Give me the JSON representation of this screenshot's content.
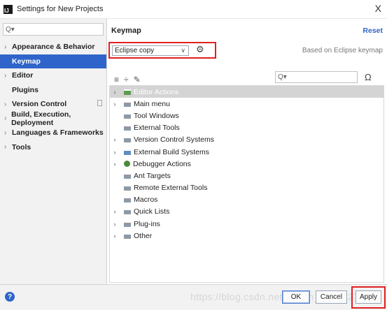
{
  "window": {
    "title": "Settings for New Projects",
    "app_icon_text": "IJ",
    "close_glyph": "X"
  },
  "sidebar": {
    "search_placeholder": "Q▾",
    "items": [
      {
        "label": "Appearance & Behavior",
        "expandable": true
      },
      {
        "label": "Keymap",
        "selected": true
      },
      {
        "label": "Editor",
        "expandable": true
      },
      {
        "label": "Plugins"
      },
      {
        "label": "Version Control",
        "expandable": true
      },
      {
        "label": "Build, Execution, Deployment",
        "expandable": true
      },
      {
        "label": "Languages & Frameworks",
        "expandable": true
      },
      {
        "label": "Tools",
        "expandable": true
      }
    ]
  },
  "main": {
    "section_title": "Keymap",
    "reset_label": "Reset",
    "scheme_value": "Eclipse copy",
    "based_on": "Based on Eclipse keymap",
    "toolbar_icons": [
      "expand-all-icon",
      "collapse-all-icon",
      "edit-icon"
    ],
    "tree_search_placeholder": "Q▾",
    "tree": [
      {
        "label": "Editor Actions",
        "arrow": true,
        "icon": "editor-actions",
        "selected": true
      },
      {
        "label": "Main menu",
        "arrow": true,
        "icon": "folder"
      },
      {
        "label": "Tool Windows",
        "arrow": false,
        "icon": "folder"
      },
      {
        "label": "External Tools",
        "arrow": false,
        "icon": "folder"
      },
      {
        "label": "Version Control Systems",
        "arrow": true,
        "icon": "folder"
      },
      {
        "label": "External Build Systems",
        "arrow": true,
        "icon": "build"
      },
      {
        "label": "Debugger Actions",
        "arrow": true,
        "icon": "bug"
      },
      {
        "label": "Ant Targets",
        "arrow": false,
        "icon": "folder"
      },
      {
        "label": "Remote External Tools",
        "arrow": false,
        "icon": "folder"
      },
      {
        "label": "Macros",
        "arrow": false,
        "icon": "folder"
      },
      {
        "label": "Quick Lists",
        "arrow": true,
        "icon": "folder"
      },
      {
        "label": "Plug-ins",
        "arrow": true,
        "icon": "folder"
      },
      {
        "label": "Other",
        "arrow": true,
        "icon": "folder"
      }
    ]
  },
  "footer": {
    "help_glyph": "?",
    "ok_label": "OK",
    "cancel_label": "Cancel",
    "apply_label": "Apply",
    "watermark": "https://blog.csdn.net/weixin_43709278"
  },
  "colors": {
    "accent": "#2f65ca",
    "highlight_box": "#e02020",
    "sidebar_bg": "#f2f2f2"
  }
}
